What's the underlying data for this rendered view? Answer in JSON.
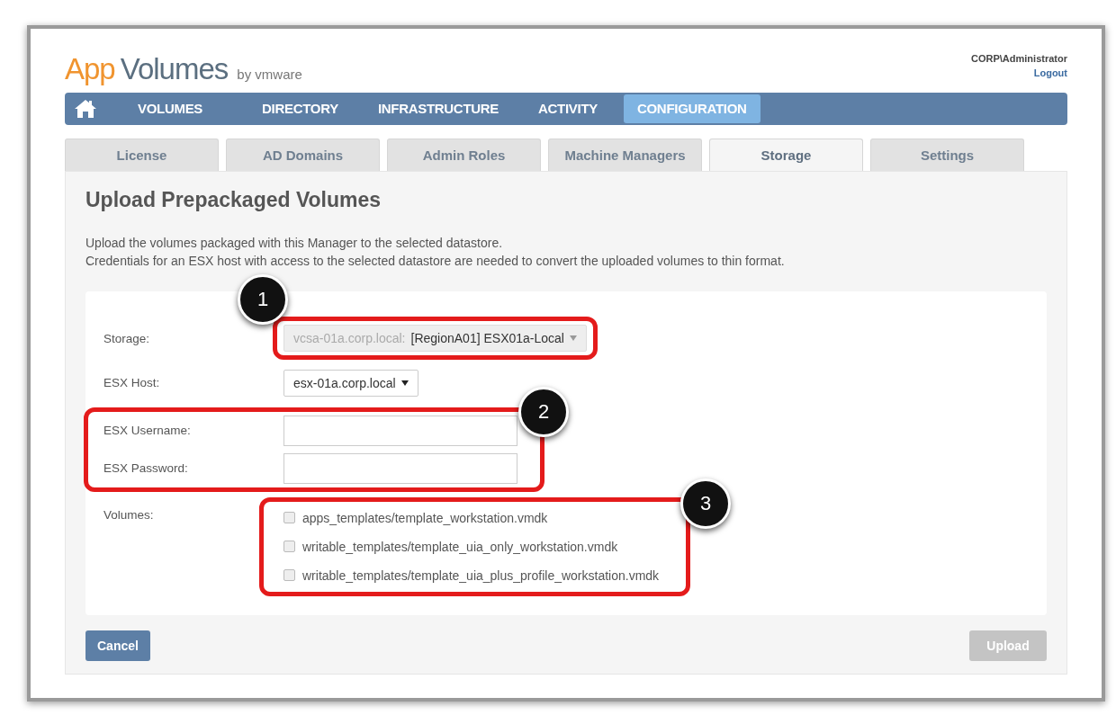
{
  "logo": {
    "first": "App",
    "second": "Volumes",
    "by": "by vmware"
  },
  "user": {
    "name": "CORP\\Administrator",
    "logout": "Logout"
  },
  "nav": [
    {
      "label": "VOLUMES",
      "selected": false
    },
    {
      "label": "DIRECTORY",
      "selected": false
    },
    {
      "label": "INFRASTRUCTURE",
      "selected": false
    },
    {
      "label": "ACTIVITY",
      "selected": false
    },
    {
      "label": "CONFIGURATION",
      "selected": true
    }
  ],
  "tabs": [
    {
      "label": "License",
      "selected": false
    },
    {
      "label": "AD Domains",
      "selected": false
    },
    {
      "label": "Admin Roles",
      "selected": false
    },
    {
      "label": "Machine Managers",
      "selected": false
    },
    {
      "label": "Storage",
      "selected": true
    },
    {
      "label": "Settings",
      "selected": false
    }
  ],
  "title": "Upload Prepackaged Volumes",
  "description": [
    "Upload the volumes packaged with this Manager to the selected datastore.",
    "Credentials for an ESX host with access to the selected datastore are needed to convert the uploaded volumes to thin format."
  ],
  "form": [
    {
      "kind": "select",
      "label": "Storage:",
      "prefix": "vcsa-01a.corp.local:",
      "value": "[RegionA01] ESX01a-Local",
      "disabled": true,
      "callout": "1"
    },
    {
      "kind": "select",
      "label": "ESX Host:",
      "value": "esx-01a.corp.local",
      "disabled": false
    },
    {
      "kind": "group",
      "callout": "2",
      "rows": [
        {
          "kind": "input",
          "label": "ESX Username:"
        },
        {
          "kind": "input",
          "label": "ESX Password:"
        }
      ]
    },
    {
      "kind": "checklist",
      "label": "Volumes:",
      "callout": "3",
      "items": [
        {
          "label": "apps_templates/template_workstation.vmdk",
          "checked": false
        },
        {
          "label": "writable_templates/template_uia_only_workstation.vmdk",
          "checked": false
        },
        {
          "label": "writable_templates/template_uia_plus_profile_workstation.vmdk",
          "checked": false
        }
      ]
    }
  ],
  "buttons": [
    {
      "label": "Cancel",
      "disabled": false
    },
    {
      "label": "Upload",
      "disabled": true
    }
  ]
}
